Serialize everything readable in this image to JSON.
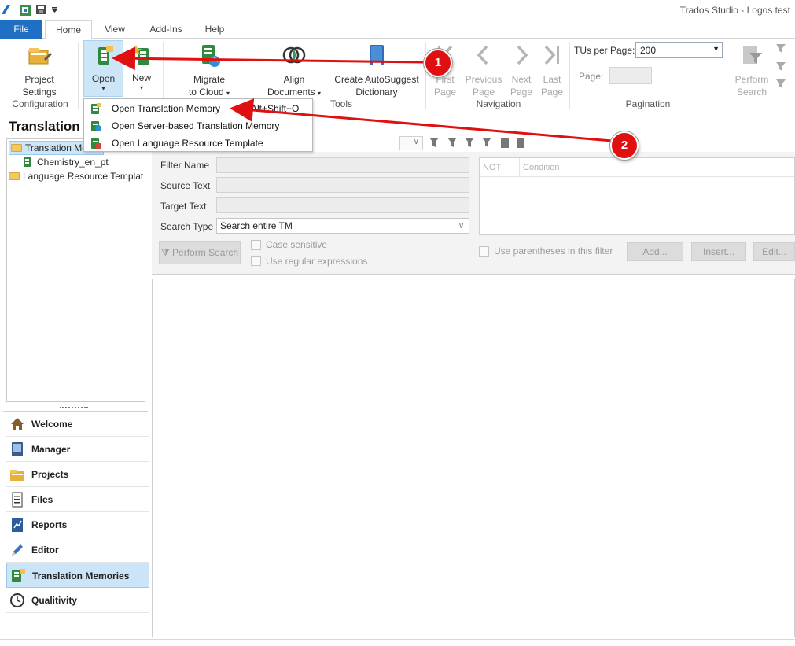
{
  "window": {
    "title": "Trados Studio - Logos test"
  },
  "tabs": [
    "File",
    "Home",
    "View",
    "Add-Ins",
    "Help"
  ],
  "ribbon": {
    "configuration": {
      "project_settings": [
        "Project",
        "Settings"
      ],
      "group": "Configuration"
    },
    "open": "Open",
    "new": "New",
    "migrate": [
      "Migrate",
      "to Cloud"
    ],
    "align": [
      "Align",
      "Documents"
    ],
    "autosuggest": [
      "Create AutoSuggest",
      "Dictionary"
    ],
    "tools_group": "Tools",
    "navigation": {
      "first": [
        "First",
        "Page"
      ],
      "previous": [
        "Previous",
        "Page"
      ],
      "next": [
        "Next",
        "Page"
      ],
      "last": [
        "Last",
        "Page"
      ],
      "group": "Navigation"
    },
    "pagination": {
      "tus_label": "TUs per Page:",
      "tus_value": "200",
      "page_label": "Page:",
      "group": "Pagination"
    },
    "perform_search": [
      "Perform",
      "Search"
    ]
  },
  "dropdown": {
    "items": [
      {
        "label": "Open Translation Memory",
        "shortcut": "Alt+Shift+O"
      },
      {
        "label": "Open Server-based Translation Memory",
        "shortcut": ""
      },
      {
        "label": "Open Language Resource Template",
        "shortcut": ""
      }
    ]
  },
  "left_panel": {
    "title": "Translation",
    "tree": [
      {
        "label": "Translation Memories"
      },
      {
        "label": "Chemistry_en_pt"
      },
      {
        "label": "Language Resource Templat"
      }
    ]
  },
  "nav": [
    "Welcome",
    "Manager",
    "Projects",
    "Files",
    "Reports",
    "Editor",
    "Translation Memories",
    "Qualitivity"
  ],
  "filter": {
    "filter_name": "Filter Name",
    "source_text": "Source Text",
    "target_text": "Target Text",
    "search_type": "Search Type",
    "search_type_value": "Search entire TM",
    "perform_search": "Perform Search",
    "case_sensitive": "Case sensitive",
    "regex": "Use regular expressions",
    "not_header": "NOT",
    "condition_header": "Condition",
    "parentheses": "Use parentheses in this filter",
    "add": "Add...",
    "insert": "Insert...",
    "edit": "Edit..."
  },
  "annotations": {
    "badge1": "1",
    "badge2": "2"
  },
  "colors": {
    "accent": "#1f6fc5",
    "annotation": "#e01010"
  }
}
